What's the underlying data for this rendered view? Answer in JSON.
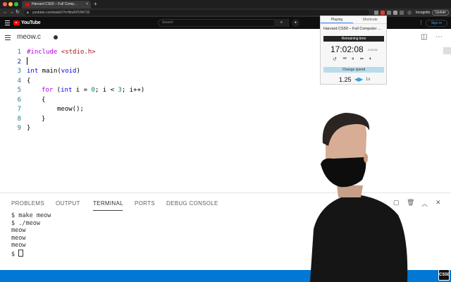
{
  "browser": {
    "tab_title": "Harvard CS50 – Full Comp…",
    "tab_close": "×",
    "new_tab": "+",
    "url": "youtube.com/watch?v=8mAITcNt710",
    "profile_label": "Incognito",
    "update_label": "Update"
  },
  "youtube": {
    "logo_text": "YouTube",
    "search_placeholder": "Search",
    "signin_label": "Sign in"
  },
  "editor": {
    "filename": "meow.c",
    "lines": [
      {
        "n": "1"
      },
      {
        "n": "2"
      },
      {
        "n": "3"
      },
      {
        "n": "4"
      },
      {
        "n": "5"
      },
      {
        "n": "6"
      },
      {
        "n": "7"
      },
      {
        "n": "8"
      },
      {
        "n": "9"
      }
    ],
    "code": {
      "l1_kw": "#include",
      "l1_str": "<stdio.h>",
      "l3_kw": "int",
      "l3_rest": " main(",
      "l3_kw2": "void",
      "l3_end": ")",
      "l4": "{",
      "l5_kw": "for",
      "l5_a": " (",
      "l5_kw2": "int",
      "l5_b": " i = ",
      "l5_n1": "0",
      "l5_c": "; i < ",
      "l5_n2": "3",
      "l5_d": "; i++)",
      "l6": "{",
      "l7": "meow();",
      "l8": "}",
      "l9": "}"
    }
  },
  "panel": {
    "tabs": [
      "PROBLEMS",
      "OUTPUT",
      "TERMINAL",
      "PORTS",
      "DEBUG CONSOLE"
    ],
    "active_tab": "TERMINAL",
    "terminal_lines": [
      "$ make meow",
      "$ ./meow",
      "meow",
      "meow",
      "meow"
    ],
    "prompt": "$ "
  },
  "popup": {
    "tab_playing": "Playing",
    "tab_shortcuts": "Shortcuts",
    "video_title": "Harvard CS50 – Full Computer …",
    "remaining_label": "Remaining time",
    "remaining_time": "17:02:08",
    "secondary_time": "-4:10:32",
    "change_speed_label": "Change speed",
    "speed": "1.25",
    "speed_alt": "1x"
  },
  "channel_logo": "CS50",
  "colors": {
    "accent_blue": "#0078d4",
    "youtube_red": "#ff0000",
    "popup_speed_bg": "#b8dcee"
  }
}
